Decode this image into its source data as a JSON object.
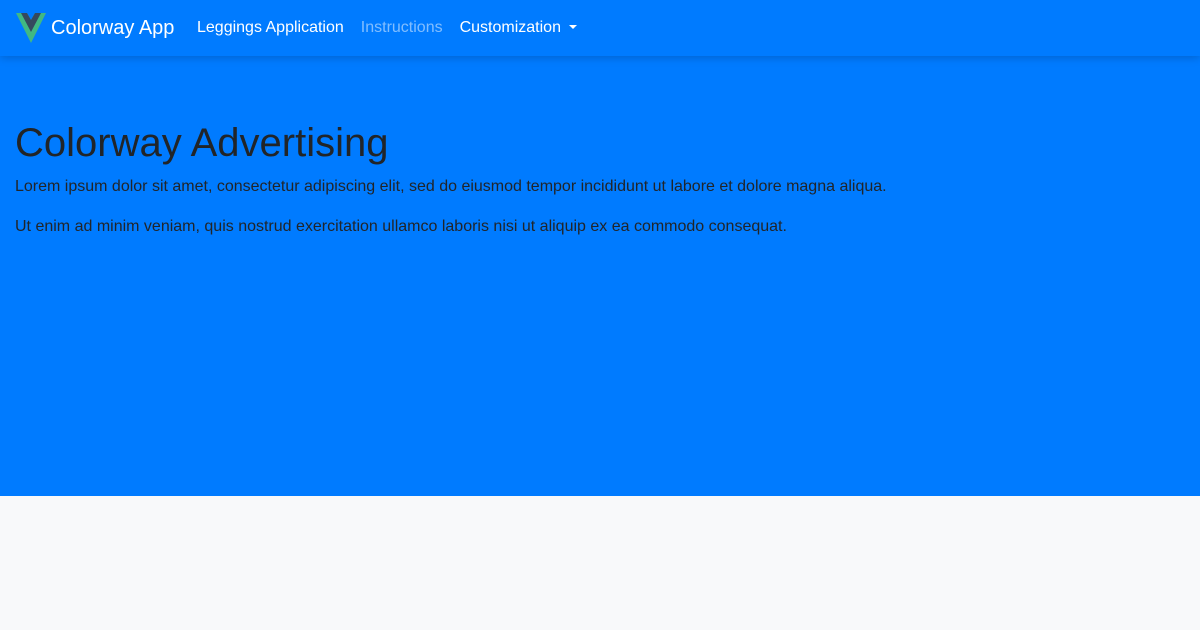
{
  "colors": {
    "primary": "#007bff",
    "text_dark": "#212529",
    "page_background": "#f8f9fa",
    "logo_outer": "#41b883",
    "logo_inner": "#35495e"
  },
  "navbar": {
    "brand": {
      "logo_icon": "vue-logo-icon",
      "title": "Colorway App"
    },
    "links": [
      {
        "label": "Leggings Application",
        "state": "active"
      },
      {
        "label": "Instructions",
        "state": "muted"
      },
      {
        "label": "Customization",
        "state": "dropdown",
        "icon": "caret-down-icon"
      }
    ]
  },
  "hero": {
    "title": "Colorway Advertising",
    "paragraphs": [
      "Lorem ipsum dolor sit amet, consectetur adipiscing elit, sed do eiusmod tempor incididunt ut labore et dolore magna aliqua.",
      "Ut enim ad minim veniam, quis nostrud exercitation ullamco laboris nisi ut aliquip ex ea commodo consequat."
    ]
  }
}
